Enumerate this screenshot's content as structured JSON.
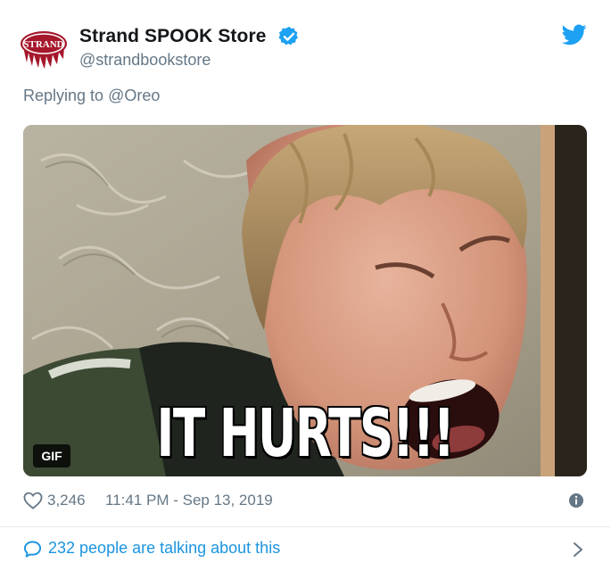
{
  "account": {
    "name": "Strand SPOOK Store",
    "handle": "@strandbookstore",
    "avatar_text": "STRAND",
    "verified": true
  },
  "reply": {
    "prefix": "Replying to ",
    "mention": "@Oreo"
  },
  "media": {
    "badge": "GIF",
    "caption": "IT HURTS!!!"
  },
  "stats": {
    "likes": "3,246",
    "timestamp": "11:41 PM - Sep 13, 2019"
  },
  "footer": {
    "talking": "232 people are talking about this"
  },
  "icons": {
    "twitter": "twitter-bird-icon",
    "verified": "verified-badge-icon",
    "like": "heart-icon",
    "info": "info-icon",
    "comment": "speech-bubble-icon",
    "chevron": "chevron-right-icon"
  },
  "colors": {
    "twitter_blue": "#1da1f2",
    "link_blue": "#1b95e0",
    "secondary": "#657786",
    "avatar_red": "#a5172a"
  }
}
